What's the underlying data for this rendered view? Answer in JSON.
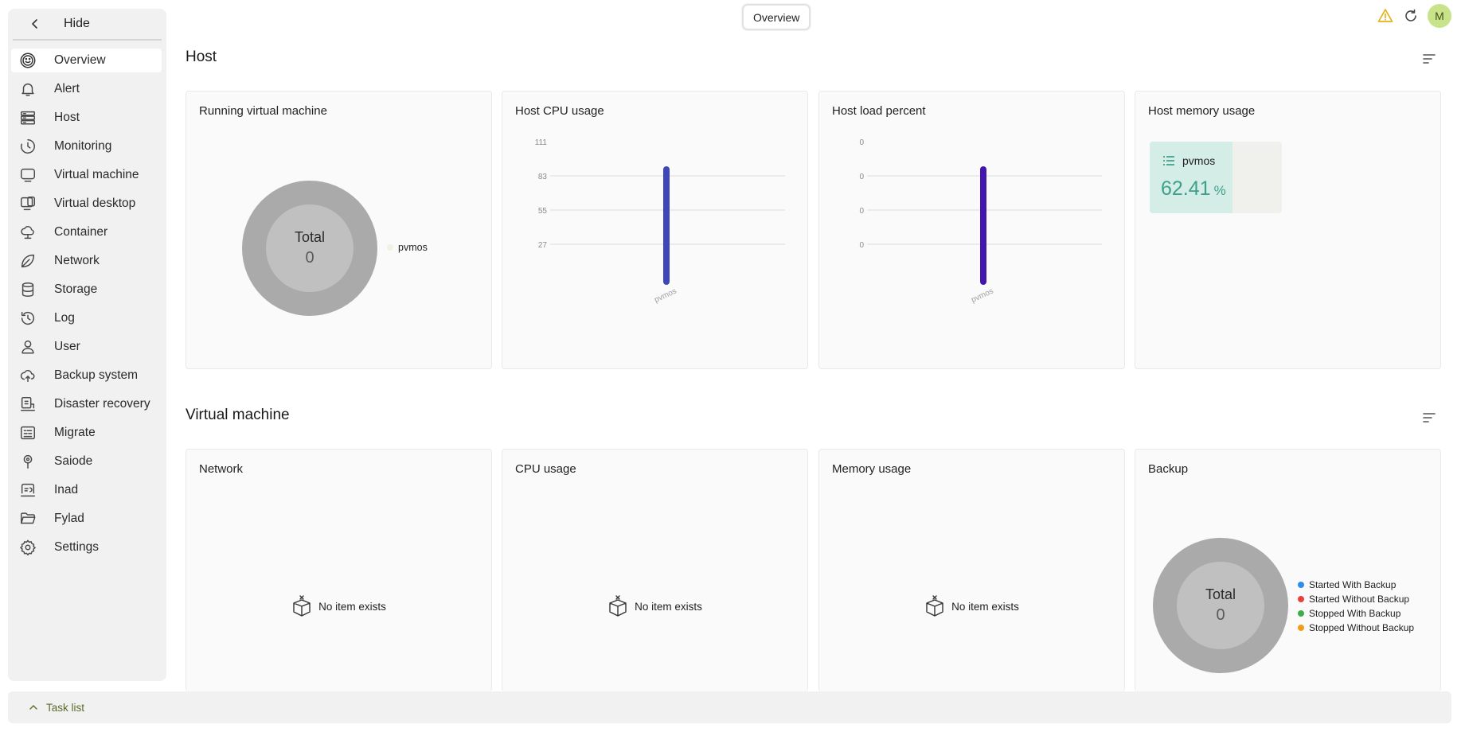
{
  "sidebar": {
    "hide_label": "Hide",
    "items": [
      {
        "label": "Overview",
        "icon": "smile-icon",
        "active": true
      },
      {
        "label": "Alert",
        "icon": "bell-icon"
      },
      {
        "label": "Host",
        "icon": "server-icon"
      },
      {
        "label": "Monitoring",
        "icon": "clock-icon"
      },
      {
        "label": "Virtual machine",
        "icon": "monitor-icon"
      },
      {
        "label": "Virtual desktop",
        "icon": "desktop-icon"
      },
      {
        "label": "Container",
        "icon": "cloud-icon"
      },
      {
        "label": "Network",
        "icon": "leaf-icon"
      },
      {
        "label": "Storage",
        "icon": "database-icon"
      },
      {
        "label": "Log",
        "icon": "history-icon"
      },
      {
        "label": "User",
        "icon": "user-icon"
      },
      {
        "label": "Backup system",
        "icon": "cloud-upload-icon"
      },
      {
        "label": "Disaster recovery",
        "icon": "recovery-icon"
      },
      {
        "label": "Migrate",
        "icon": "migrate-icon"
      },
      {
        "label": "Saiode",
        "icon": "pin-icon"
      },
      {
        "label": "Inad",
        "icon": "inad-icon"
      },
      {
        "label": "Fylad",
        "icon": "folder-icon"
      },
      {
        "label": "Settings",
        "icon": "gear-icon"
      }
    ]
  },
  "top": {
    "tab_label": "Overview",
    "avatar_initial": "M"
  },
  "taskbar": {
    "label": "Task list"
  },
  "host_section": {
    "title": "Host",
    "running_vm": {
      "title": "Running virtual machine",
      "total_label": "Total",
      "total_value": "0",
      "legend": "pvmos"
    },
    "cpu": {
      "title": "Host CPU usage"
    },
    "load": {
      "title": "Host load percent"
    },
    "memory": {
      "title": "Host memory usage",
      "name": "pvmos",
      "value": "62.41",
      "unit": "%",
      "fill_percent": 62.41
    }
  },
  "vm_section": {
    "title": "Virtual machine",
    "network": {
      "title": "Network",
      "empty": "No item exists"
    },
    "cpu": {
      "title": "CPU usage",
      "empty": "No item exists"
    },
    "memory": {
      "title": "Memory usage",
      "empty": "No item exists"
    },
    "backup": {
      "title": "Backup",
      "total_label": "Total",
      "total_value": "0",
      "legend": [
        {
          "label": "Started With Backup",
          "color": "#2d8cf0"
        },
        {
          "label": "Started Without Backup",
          "color": "#e8413b"
        },
        {
          "label": "Stopped With Backup",
          "color": "#3fae4a"
        },
        {
          "label": "Stopped Without Backup",
          "color": "#f39c1a"
        }
      ]
    }
  },
  "chart_data": [
    {
      "type": "bar",
      "chart": "Host CPU usage",
      "categories": [
        "pvmos"
      ],
      "values": [
        92
      ],
      "y_ticks": [
        "111",
        "83",
        "55",
        "27"
      ],
      "ylim": [
        0,
        111
      ],
      "color": "#3f47b8"
    },
    {
      "type": "bar",
      "chart": "Host load percent",
      "categories": [
        "pvmos"
      ],
      "values": [
        0
      ],
      "y_ticks": [
        "0",
        "0",
        "0",
        "0"
      ],
      "color": "#4416b0"
    }
  ]
}
